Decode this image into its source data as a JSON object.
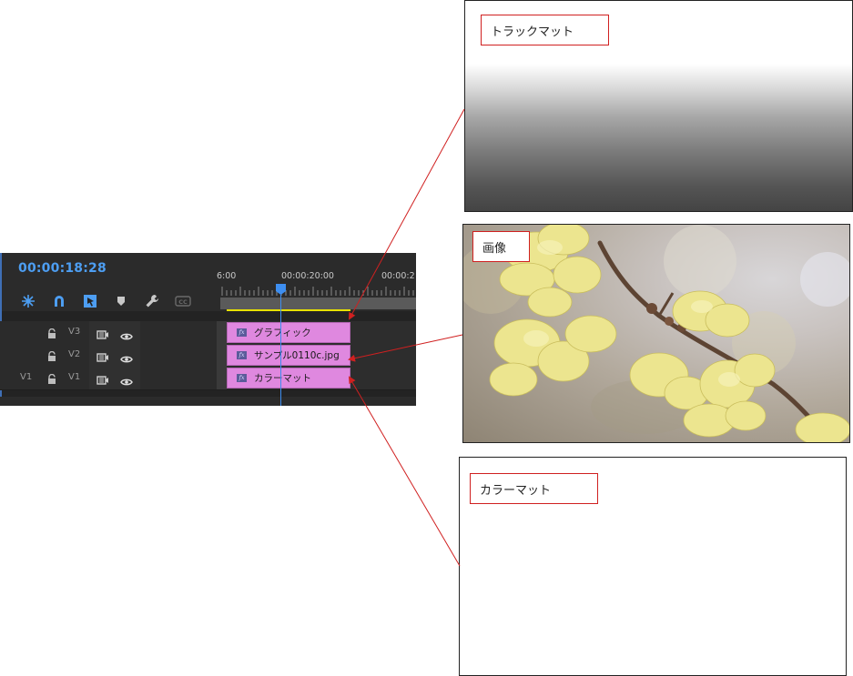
{
  "timeline": {
    "timecode": "00:00:18:28",
    "ruler_labels": [
      "6:00",
      "00:00:20:00",
      "00:00:2"
    ],
    "tools": [
      "snap-icon",
      "magnet-icon",
      "linked-selection-icon",
      "marker-icon",
      "wrench-icon",
      "captions-icon"
    ],
    "tracks": [
      {
        "patch": "",
        "name": "V3",
        "clip": "グラフィック"
      },
      {
        "patch": "",
        "name": "V2",
        "clip": "サンプル0110c.jpg"
      },
      {
        "patch": "V1",
        "name": "V1",
        "clip": "カラーマット"
      }
    ],
    "fx_label": "fx"
  },
  "callouts": {
    "track_matte": "トラックマット",
    "image": "画像",
    "color_matte": "カラーマット"
  },
  "colors": {
    "clip": "#df88df",
    "timecode": "#4d9ef2",
    "playhead": "#3d8ef0",
    "work_area": "#e8e200",
    "arrow": "#d02020"
  }
}
